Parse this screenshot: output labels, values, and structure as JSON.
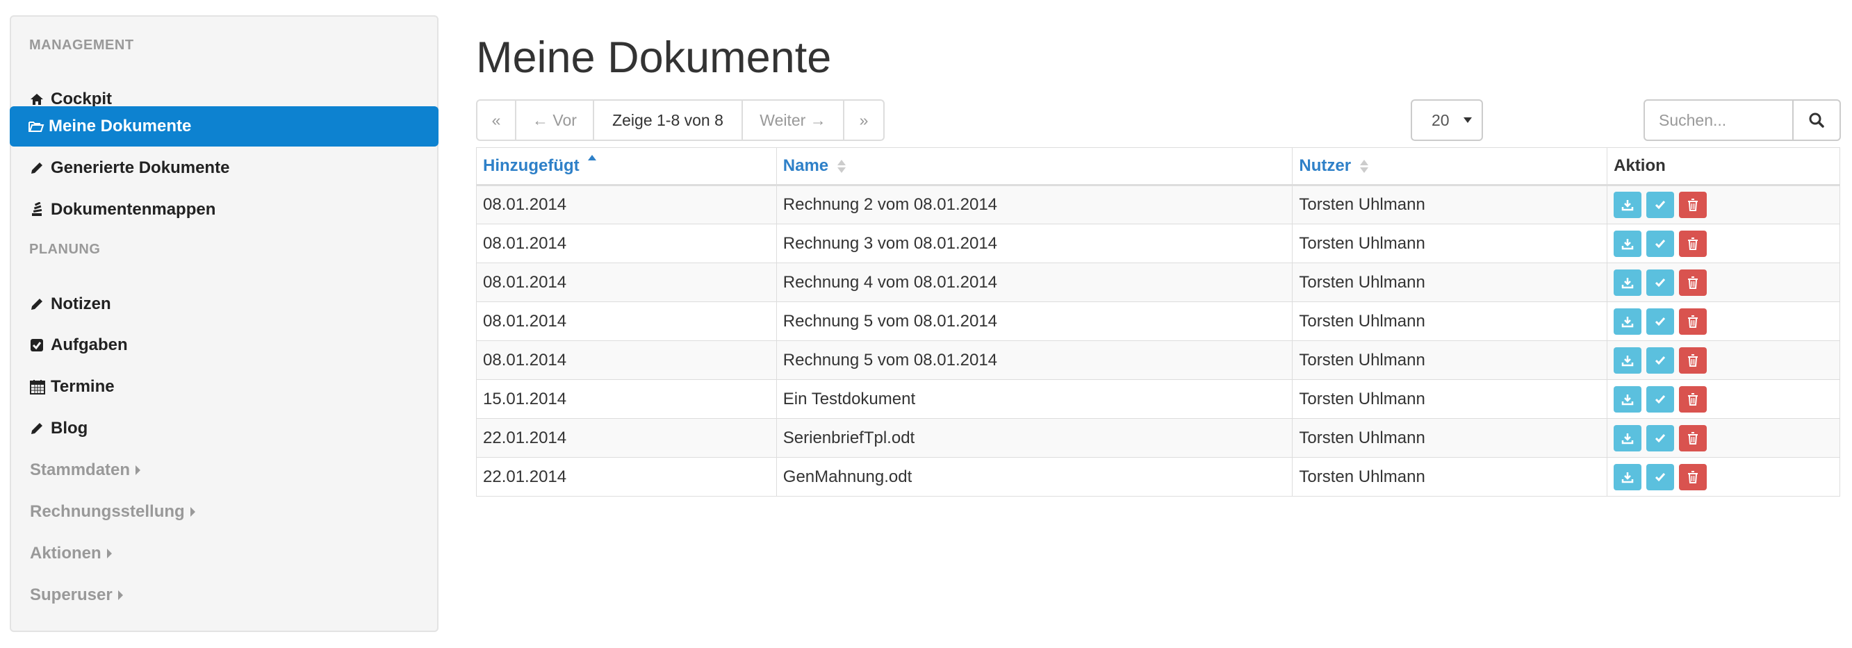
{
  "sidebar": {
    "sections": [
      {
        "header": "MANAGEMENT"
      },
      {
        "header": "PLANUNG"
      }
    ],
    "items": [
      {
        "label": "Cockpit",
        "icon": "home-icon"
      },
      {
        "label": "Meine Dokumente",
        "icon": "folder-open-icon",
        "active": true
      },
      {
        "label": "Generierte Dokumente",
        "icon": "pencil-icon"
      },
      {
        "label": "Dokumentenmappen",
        "icon": "stack-icon"
      },
      {
        "label": "Notizen",
        "icon": "pencil-icon"
      },
      {
        "label": "Aufgaben",
        "icon": "check-square-icon"
      },
      {
        "label": "Termine",
        "icon": "calendar-icon"
      },
      {
        "label": "Blog",
        "icon": "pencil-icon"
      },
      {
        "label": "Stammdaten",
        "icon": "caret-right-icon"
      },
      {
        "label": "Rechnungsstellung",
        "icon": "caret-right-icon"
      },
      {
        "label": "Aktionen",
        "icon": "caret-right-icon"
      },
      {
        "label": "Superuser",
        "icon": "caret-right-icon"
      }
    ]
  },
  "main": {
    "title": "Meine Dokumente",
    "pager": {
      "first": "«",
      "prev": "← Vor",
      "info": "Zeige 1-8 von 8",
      "next": "Weiter →",
      "last": "»"
    },
    "per_page": "20",
    "search": {
      "placeholder": "Suchen..."
    },
    "table": {
      "columns": [
        "Hinzugefügt",
        "Name",
        "Nutzer",
        "Aktion"
      ],
      "rows": [
        {
          "date": "08.01.2014",
          "name": "Rechnung 2 vom 08.01.2014",
          "user": "Torsten Uhlmann"
        },
        {
          "date": "08.01.2014",
          "name": "Rechnung 3 vom 08.01.2014",
          "user": "Torsten Uhlmann"
        },
        {
          "date": "08.01.2014",
          "name": "Rechnung 4 vom 08.01.2014",
          "user": "Torsten Uhlmann"
        },
        {
          "date": "08.01.2014",
          "name": "Rechnung 5 vom 08.01.2014",
          "user": "Torsten Uhlmann"
        },
        {
          "date": "08.01.2014",
          "name": "Rechnung 5 vom 08.01.2014",
          "user": "Torsten Uhlmann"
        },
        {
          "date": "15.01.2014",
          "name": "Ein Testdokument",
          "user": "Torsten Uhlmann"
        },
        {
          "date": "22.01.2014",
          "name": "SerienbriefTpl.odt",
          "user": "Torsten Uhlmann"
        },
        {
          "date": "22.01.2014",
          "name": "GenMahnung.odt",
          "user": "Torsten Uhlmann"
        }
      ],
      "row_actions": [
        "download-icon",
        "check-icon",
        "trash-icon"
      ]
    }
  },
  "colors": {
    "accent": "#0d82d0",
    "link": "#2e80c8",
    "info": "#5bc0de",
    "danger": "#d9534f"
  }
}
